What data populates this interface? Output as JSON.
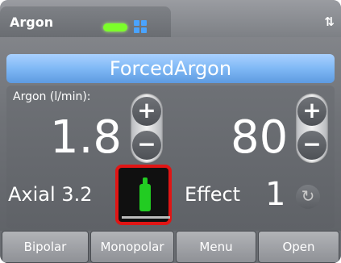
{
  "header": {
    "title": "Argon",
    "status_indicator_color": "#7cff2a",
    "status_grid_color": "#4aa3ff",
    "swap_icon": "swap-arrows-icon",
    "swap_glyph": "⇅"
  },
  "mode": {
    "name": "ForcedArgon"
  },
  "flow": {
    "label": "Argon (l/min):",
    "value": "1.8",
    "plus": "+",
    "minus": "−"
  },
  "effect_setting": {
    "value": "80",
    "plus": "+",
    "minus": "−"
  },
  "axial": {
    "label": "Axial 3.2",
    "nozzle_icon": "argon-nozzle-icon",
    "highlight_color": "#e01515",
    "nozzle_color": "#22cc22"
  },
  "effect": {
    "label": "Effect",
    "number": "1",
    "reset_icon": "reset-icon",
    "reset_glyph": "↻"
  },
  "footer": {
    "buttons": [
      "Bipolar",
      "Monopolar",
      "Menu",
      "Open"
    ]
  }
}
